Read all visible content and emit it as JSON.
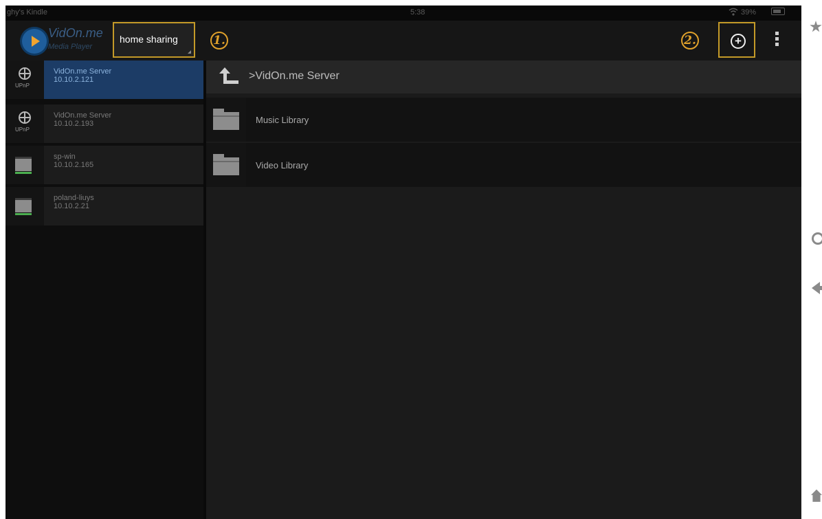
{
  "status_bar": {
    "device_name": "ghy's Kindle",
    "time": "5:38",
    "battery": "39%"
  },
  "app": {
    "logo_title": "VidOn.me",
    "logo_subtitle": "Media Player",
    "source_spinner": "home sharing",
    "callout_1": "1.",
    "callout_2": "2.",
    "icons": {
      "add": "add-circle-icon",
      "overflow": "overflow-menu-icon"
    }
  },
  "sidebar": {
    "servers": [
      {
        "name": "VidOn.me Server",
        "ip": "10.10.2.121",
        "type": "upnp",
        "icon_label": "UPnP",
        "selected": true
      },
      {
        "name": "VidOn.me Server",
        "ip": "10.10.2.193",
        "type": "upnp",
        "icon_label": "UPnP",
        "selected": false
      },
      {
        "name": "sp-win",
        "ip": "10.10.2.165",
        "type": "pc",
        "selected": false
      },
      {
        "name": "poland-liuys",
        "ip": "10.10.2.21",
        "type": "pc",
        "selected": false
      }
    ]
  },
  "content": {
    "breadcrumb": ">VidOn.me Server",
    "folders": [
      {
        "label": "Music Library"
      },
      {
        "label": "Video Library"
      }
    ]
  },
  "colors": {
    "selection": "#1c3c66",
    "highlight_outline": "#c49a28",
    "callout": "#e0a12b"
  }
}
